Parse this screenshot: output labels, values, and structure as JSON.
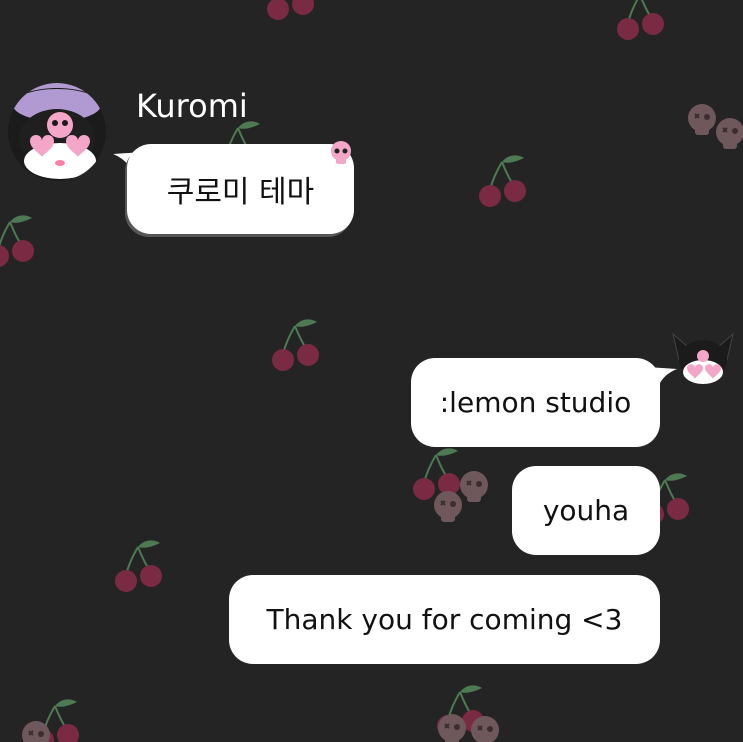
{
  "conversation": {
    "contact_name": "Kuromi",
    "messages": [
      {
        "direction": "received",
        "text": "쿠로미 테마"
      },
      {
        "direction": "sent",
        "text": ":lemon studio"
      },
      {
        "direction": "sent",
        "text": "youha"
      },
      {
        "direction": "sent",
        "text": "Thank you for coming <3"
      }
    ]
  },
  "icons": {
    "contact_avatar": "kuromi-avatar-icon",
    "my_avatar": "kuromi-sticker-icon",
    "badge": "skull-icon",
    "wallpaper_pattern": "cherry-icon"
  },
  "colors": {
    "background": "#242424",
    "bubble": "#ffffff",
    "text_primary": "#111111",
    "name_text": "#ffffff",
    "cherry": "#7a2a42",
    "leaf": "#4d7a52",
    "pink_accent": "#f4a6c8"
  }
}
